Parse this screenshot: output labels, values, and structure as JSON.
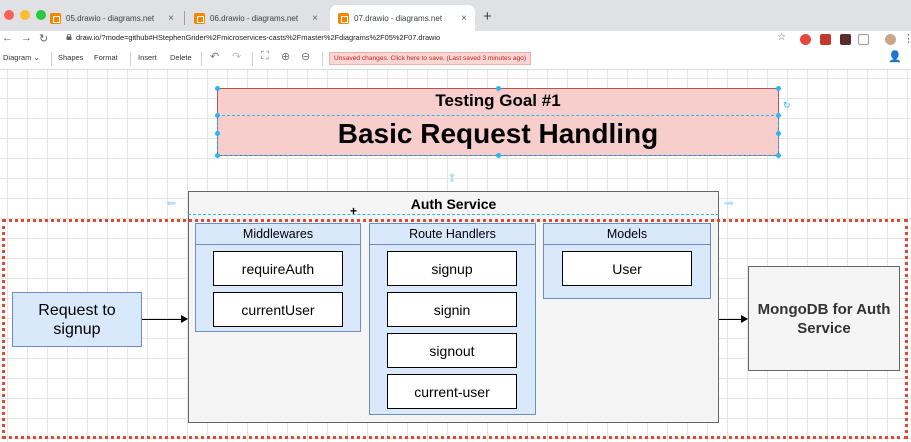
{
  "browser": {
    "tabs": [
      {
        "label": "05.drawio - diagrams.net",
        "active": false
      },
      {
        "label": "06.drawio - diagrams.net",
        "active": false
      },
      {
        "label": "07.drawio - diagrams.net",
        "active": true
      }
    ],
    "new_tab_label": "+",
    "close_label": "×",
    "url": "draw.io/?mode=github#HStephenGrider%2Fmicroservices-casts%2Fmaster%2Fdiagrams%2F05%2F07.drawio"
  },
  "toolbar": {
    "diagram_menu": "Diagram",
    "shapes": "Shapes",
    "format": "Format",
    "insert": "Insert",
    "delete": "Delete",
    "unsaved_notice": "Unsaved changes. Click here to save. (Last saved 3 minutes ago)"
  },
  "diagram": {
    "goal_title": "Testing Goal #1",
    "goal_subtitle": "Basic Request Handling",
    "auth_service_title": "Auth Service",
    "middlewares": {
      "title": "Middlewares",
      "items": [
        "requireAuth",
        "currentUser"
      ]
    },
    "route_handlers": {
      "title": "Route Handlers",
      "items": [
        "signup",
        "signin",
        "signout",
        "current-user"
      ]
    },
    "models": {
      "title": "Models",
      "items": [
        "User"
      ]
    },
    "request_node": "Request to signup",
    "mongodb_node": "MongoDB for Auth Service"
  },
  "colors": {
    "goal_fill": "#f8cecc",
    "goal_border": "#b85450",
    "group_fill": "#dae8fc",
    "group_border": "#6c8ebf",
    "selection": "#29b6f2",
    "dotted_red": "#e0492f"
  }
}
